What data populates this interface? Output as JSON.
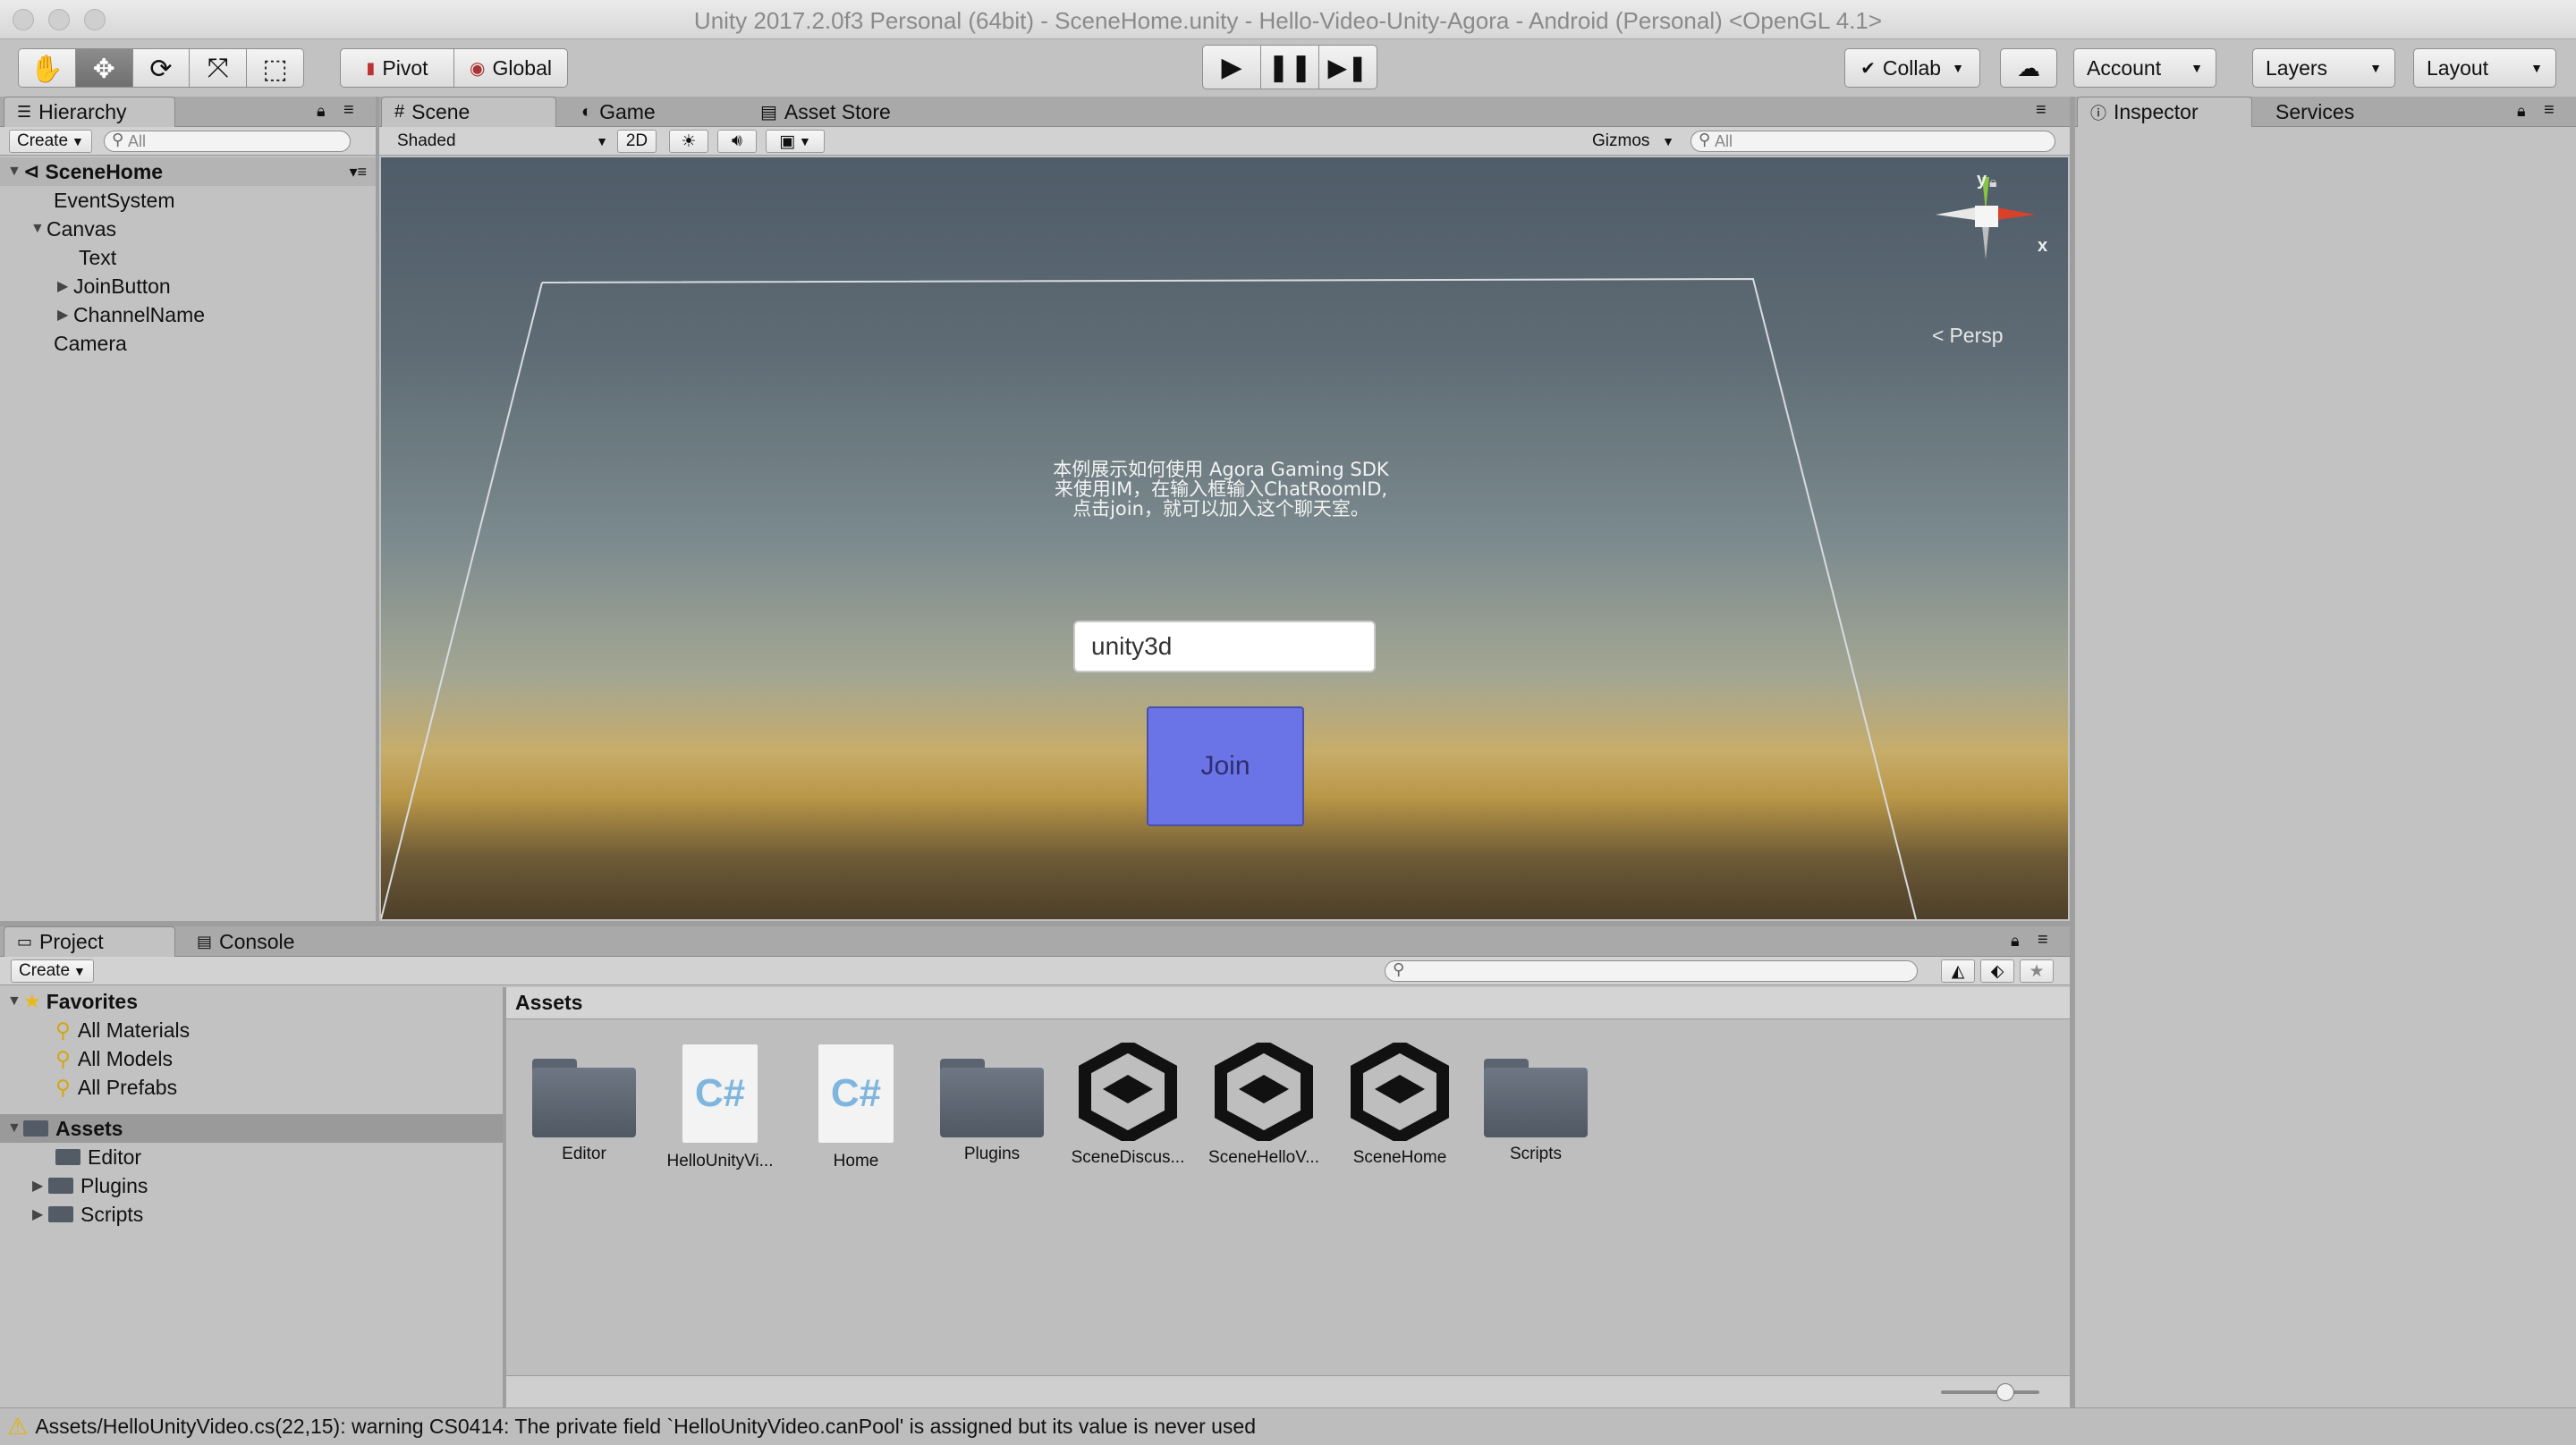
{
  "window": {
    "title": "Unity 2017.2.0f3 Personal (64bit) - SceneHome.unity - Hello-Video-Unity-Agora - Android (Personal) <OpenGL 4.1>"
  },
  "toolbar": {
    "pivot": "Pivot",
    "global": "Global",
    "collab": "Collab",
    "account": "Account",
    "layers": "Layers",
    "layout": "Layout"
  },
  "hierarchy": {
    "tab": "Hierarchy",
    "create": "Create",
    "search_placeholder": "All",
    "scene": "SceneHome",
    "items": [
      {
        "label": "EventSystem"
      },
      {
        "label": "Canvas"
      },
      {
        "label": "Text"
      },
      {
        "label": "JoinButton"
      },
      {
        "label": "ChannelName"
      },
      {
        "label": "Camera"
      }
    ]
  },
  "scene_tabs": {
    "scene": "Scene",
    "game": "Game",
    "asset_store": "Asset Store"
  },
  "scene_toolbar": {
    "shading": "Shaded",
    "mode_2d": "2D",
    "gizmos": "Gizmos",
    "search_placeholder": "All"
  },
  "scene_content": {
    "info_line1": "本例展示如何使用 Agora Gaming SDK",
    "info_line2": "来使用IM，在输入框输入ChatRoomID,",
    "info_line3": "点击join，就可以加入这个聊天室。",
    "channel_value": "unity3d",
    "join_label": "Join",
    "gizmo_y": "y",
    "gizmo_x": "x",
    "projection": "Persp"
  },
  "right_tabs": {
    "inspector": "Inspector",
    "services": "Services"
  },
  "bottom_tabs": {
    "project": "Project",
    "console": "Console"
  },
  "project": {
    "create": "Create",
    "favorites_label": "Favorites",
    "favorites": [
      {
        "label": "All Materials"
      },
      {
        "label": "All Models"
      },
      {
        "label": "All Prefabs"
      }
    ],
    "assets_label": "Assets",
    "asset_folders": [
      {
        "label": "Editor"
      },
      {
        "label": "Plugins"
      },
      {
        "label": "Scripts"
      }
    ],
    "breadcrumb": "Assets",
    "grid": [
      {
        "label": "Editor",
        "kind": "folder"
      },
      {
        "label": "HelloUnityVi...",
        "kind": "script"
      },
      {
        "label": "Home",
        "kind": "script"
      },
      {
        "label": "Plugins",
        "kind": "folder"
      },
      {
        "label": "SceneDiscus...",
        "kind": "scene"
      },
      {
        "label": "SceneHelloV...",
        "kind": "scene"
      },
      {
        "label": "SceneHome",
        "kind": "scene"
      },
      {
        "label": "Scripts",
        "kind": "folder"
      }
    ]
  },
  "status": {
    "message": "Assets/HelloUnityVideo.cs(22,15): warning CS0414: The private field `HelloUnityVideo.canPool' is assigned but its value is never used"
  }
}
